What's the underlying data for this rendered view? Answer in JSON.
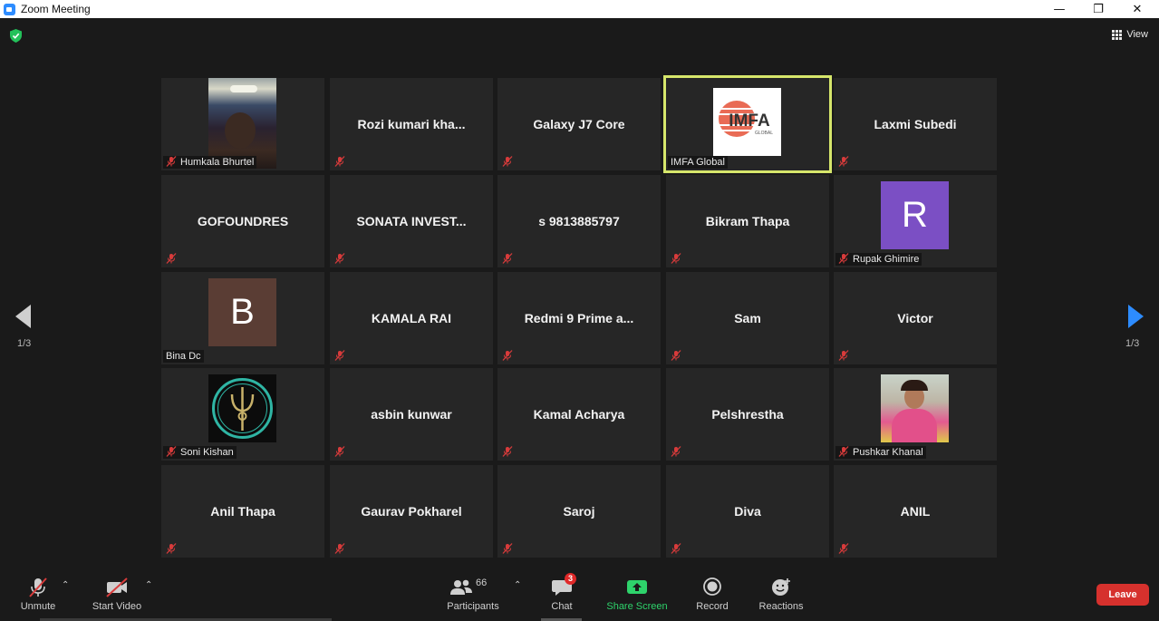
{
  "window": {
    "title": "Zoom Meeting",
    "minimize": "—",
    "restore": "❐",
    "close": "✕"
  },
  "view_button": {
    "label": "View"
  },
  "pagination": {
    "left": "1/3",
    "right": "1/3"
  },
  "tiles": [
    {
      "name": "Humkala Bhurtel",
      "kind": "photo"
    },
    {
      "name": "Rozi  kumari  kha..."
    },
    {
      "name": "Galaxy J7 Core"
    },
    {
      "name": "IMFA Global",
      "kind": "logo",
      "logo_text": "IMFA",
      "logo_sub": "GLOBAL"
    },
    {
      "name": "Laxmi Subedi"
    },
    {
      "name": "GOFOUNDRES"
    },
    {
      "name": "SONATA  INVEST..."
    },
    {
      "name": "s 9813885797"
    },
    {
      "name": "Bikram Thapa"
    },
    {
      "name": "Rupak Ghimire",
      "kind": "letter",
      "letter": "R",
      "color": "#7b4fc4"
    },
    {
      "name": "Bina Dc",
      "kind": "letter",
      "letter": "B",
      "color": "#5a3d34"
    },
    {
      "name": "KAMALA RAI"
    },
    {
      "name": "Redmi 9 Prime a..."
    },
    {
      "name": "Sam"
    },
    {
      "name": "Victor"
    },
    {
      "name": "Soni Kishan",
      "kind": "emblem"
    },
    {
      "name": "asbin kunwar"
    },
    {
      "name": "Kamal Acharya"
    },
    {
      "name": "Pelshrestha"
    },
    {
      "name": "Pushkar Khanal",
      "kind": "portrait"
    },
    {
      "name": "Anil Thapa"
    },
    {
      "name": "Gaurav Pokharel"
    },
    {
      "name": "Saroj"
    },
    {
      "name": "Diva"
    },
    {
      "name": "ANIL"
    }
  ],
  "toolbar": {
    "unmute": "Unmute",
    "start_video": "Start Video",
    "participants": "Participants",
    "participants_count": "66",
    "chat": "Chat",
    "chat_badge": "3",
    "share_screen": "Share Screen",
    "record": "Record",
    "reactions": "Reactions",
    "leave": "Leave"
  },
  "colors": {
    "accent": "#2d8cff",
    "active_speaker": "#d6e66b",
    "share_green": "#2ed36b",
    "leave_red": "#d6312d",
    "muted_red": "#d83b3b"
  }
}
